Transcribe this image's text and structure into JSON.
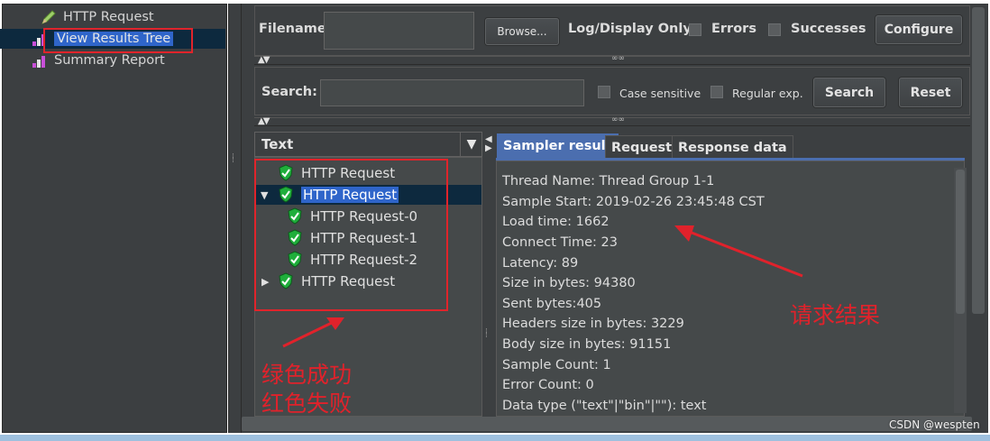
{
  "left_tree": {
    "items": [
      {
        "label": "HTTP Request",
        "icon": "pencil-icon"
      },
      {
        "label": "View Results Tree",
        "icon": "chart-icon"
      },
      {
        "label": "Summary Report",
        "icon": "chart-icon"
      }
    ]
  },
  "file_row": {
    "filename_label": "Filename",
    "browse_label": "Browse...",
    "log_display_label": "Log/Display Only:",
    "errors_label": "Errors",
    "successes_label": "Successes",
    "configure_label": "Configure"
  },
  "search_row": {
    "search_label": "Search:",
    "case_sensitive_label": "Case sensitive",
    "regular_exp_label": "Regular exp.",
    "search_button": "Search",
    "reset_button": "Reset"
  },
  "renderer": {
    "selected": "Text"
  },
  "result_tree": {
    "items": [
      {
        "label": "HTTP Request",
        "status": "success"
      },
      {
        "label": "HTTP Request",
        "status": "success",
        "expanded": true,
        "selected": true
      },
      {
        "label": "HTTP Request-0",
        "status": "success"
      },
      {
        "label": "HTTP Request-1",
        "status": "success"
      },
      {
        "label": "HTTP Request-2",
        "status": "success"
      },
      {
        "label": "HTTP Request",
        "status": "success",
        "expanded": false
      }
    ]
  },
  "tabs": {
    "sampler_result": "Sampler result",
    "request": "Request",
    "response_data": "Response data",
    "active": "sampler_result"
  },
  "sampler_result": {
    "lines": [
      "Thread Name: Thread Group 1-1",
      "Sample Start: 2019-02-26 23:45:48 CST",
      "Load time: 1662",
      "Connect Time: 23",
      "Latency: 89",
      "Size in bytes: 94380",
      "Sent bytes:405",
      "Headers size in bytes: 3229",
      "Body size in bytes: 91151",
      "Sample Count: 1",
      "Error Count: 0",
      "Data type (\"text\"|\"bin\"|\"\"): text"
    ]
  },
  "annotations": {
    "left_line1": "绿色成功",
    "left_line2": "红色失败",
    "right": "请求结果",
    "color": "#e0222b"
  },
  "watermark": "CSDN @wespten",
  "colors": {
    "panel_bg": "#3c3f41",
    "selection": "#2f65ca",
    "tab_active": "#4b6eaf",
    "success": "#1fae3b",
    "annotation_red": "#e0222b"
  }
}
